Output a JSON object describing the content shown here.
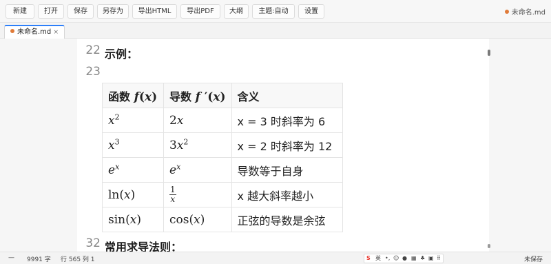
{
  "toolbar": {
    "buttons": [
      "新建",
      "打开",
      "保存",
      "另存为",
      "导出HTML",
      "导出PDF",
      "大纲",
      "主题:自动",
      "设置"
    ],
    "file_status": "未命名.md"
  },
  "tabs": [
    {
      "label": "未命名.md",
      "close": "×"
    }
  ],
  "editor": {
    "line_numbers": [
      "22",
      "23",
      "32"
    ],
    "heading_example": "示例：",
    "heading_derivative": "常用求导法则：",
    "table": {
      "headers": [
        "函数 ",
        "导数 ",
        "含义"
      ],
      "rows": [
        {
          "meaning": "x = 3 时斜率为 6"
        },
        {
          "meaning": "x = 2 时斜率为 12"
        },
        {
          "meaning": "导数等于自身"
        },
        {
          "meaning": "x 越大斜率越小"
        },
        {
          "meaning": "正弦的导数是余弦"
        }
      ]
    }
  },
  "statusbar": {
    "word_count": "9991 字",
    "cursor": "行 565 列 1",
    "save_status": "未保存",
    "dash": "—"
  },
  "ime": {
    "logo": "S",
    "lang": "英",
    "icons": [
      "punctuation-icon",
      "emoji-icon",
      "mic-icon",
      "keyboard-icon",
      "skin-icon",
      "tools-icon",
      "apps-icon"
    ]
  },
  "colors": {
    "accent": "#2d7ff9",
    "unsaved_dot": "#e07b39",
    "ime_red": "#e8382f"
  }
}
